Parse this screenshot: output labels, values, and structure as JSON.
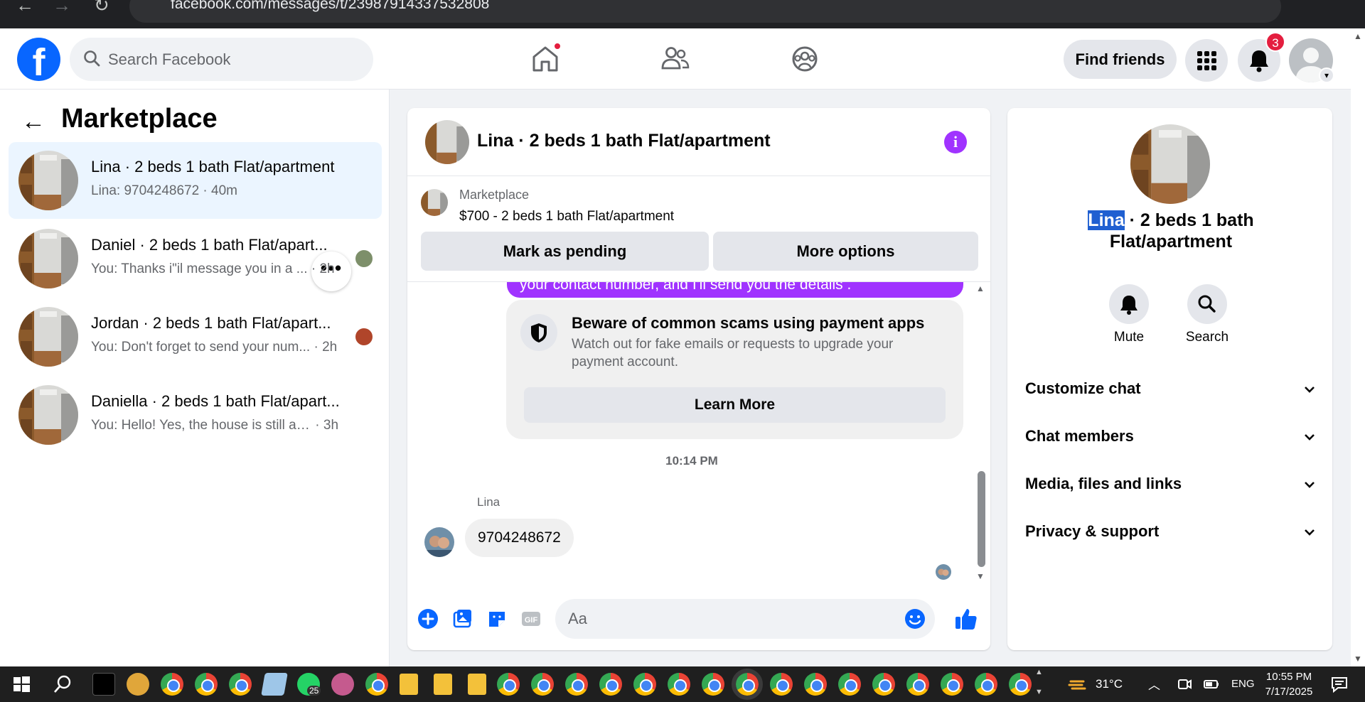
{
  "browser": {
    "url": "facebook.com/messages/t/23987914337532808",
    "back_glyph": "←",
    "forward_glyph": "→",
    "reload_glyph": "↻"
  },
  "header": {
    "logo_letter": "f",
    "search_placeholder": "Search Facebook",
    "find_friends": "Find friends",
    "notification_count": "3",
    "brand_color": "#0866ff"
  },
  "left": {
    "back_glyph": "←",
    "title": "Marketplace",
    "more_glyph": "•••",
    "conversations": [
      {
        "name": "Lina · 2 beds 1 bath Flat/apartment",
        "preview": "Lina: 9704248672",
        "time": "40m"
      },
      {
        "name": "Daniel · 2 beds 1 bath Flat/apart...",
        "preview": "You: Thanks i\"il message you in a ...",
        "time": "2h"
      },
      {
        "name": "Jordan · 2 beds 1 bath Flat/apart...",
        "preview": "You: Don't forget to send your num...",
        "time": "2h"
      },
      {
        "name": "Daniella · 2 beds 1 bath Flat/apart...",
        "preview": "You: Hello! Yes, the house is still availa...",
        "time": "3h"
      }
    ]
  },
  "chat": {
    "title": "Lina · 2 beds 1 bath Flat/apartment",
    "info_glyph": "i",
    "listing_source": "Marketplace",
    "listing_title": "$700 - 2 beds 1 bath Flat/apartment",
    "mark_pending": "Mark as pending",
    "more_options": "More options",
    "partial_message": "your contact number, and I'll send you the details .",
    "scam_title": "Beware of common scams using payment apps",
    "scam_body": "Watch out for fake emails or requests to upgrade your payment account.",
    "learn_more": "Learn More",
    "timestamp": "10:14 PM",
    "sender_name": "Lina",
    "received_message": "9704248672",
    "composer_placeholder": "Aa",
    "scroll_up_glyph": "▲",
    "scroll_down_glyph": "▼",
    "accent_color": "#a033ff"
  },
  "right": {
    "name_highlight": "Lina",
    "name_rest": " · 2 beds 1 bath Flat/apartment",
    "mute_label": "Mute",
    "search_label": "Search",
    "sections": [
      "Customize chat",
      "Chat members",
      "Media, files and links",
      "Privacy & support"
    ]
  },
  "page_scroll": {
    "up_glyph": "▲",
    "down_glyph": "▼"
  },
  "taskbar": {
    "weather": "31°C",
    "language": "ENG",
    "time": "10:55 PM",
    "date": "7/17/2025",
    "whatsapp_badge": "25",
    "chevron_glyph": "︿",
    "up_glyph": "▲",
    "down_glyph": "▼"
  }
}
